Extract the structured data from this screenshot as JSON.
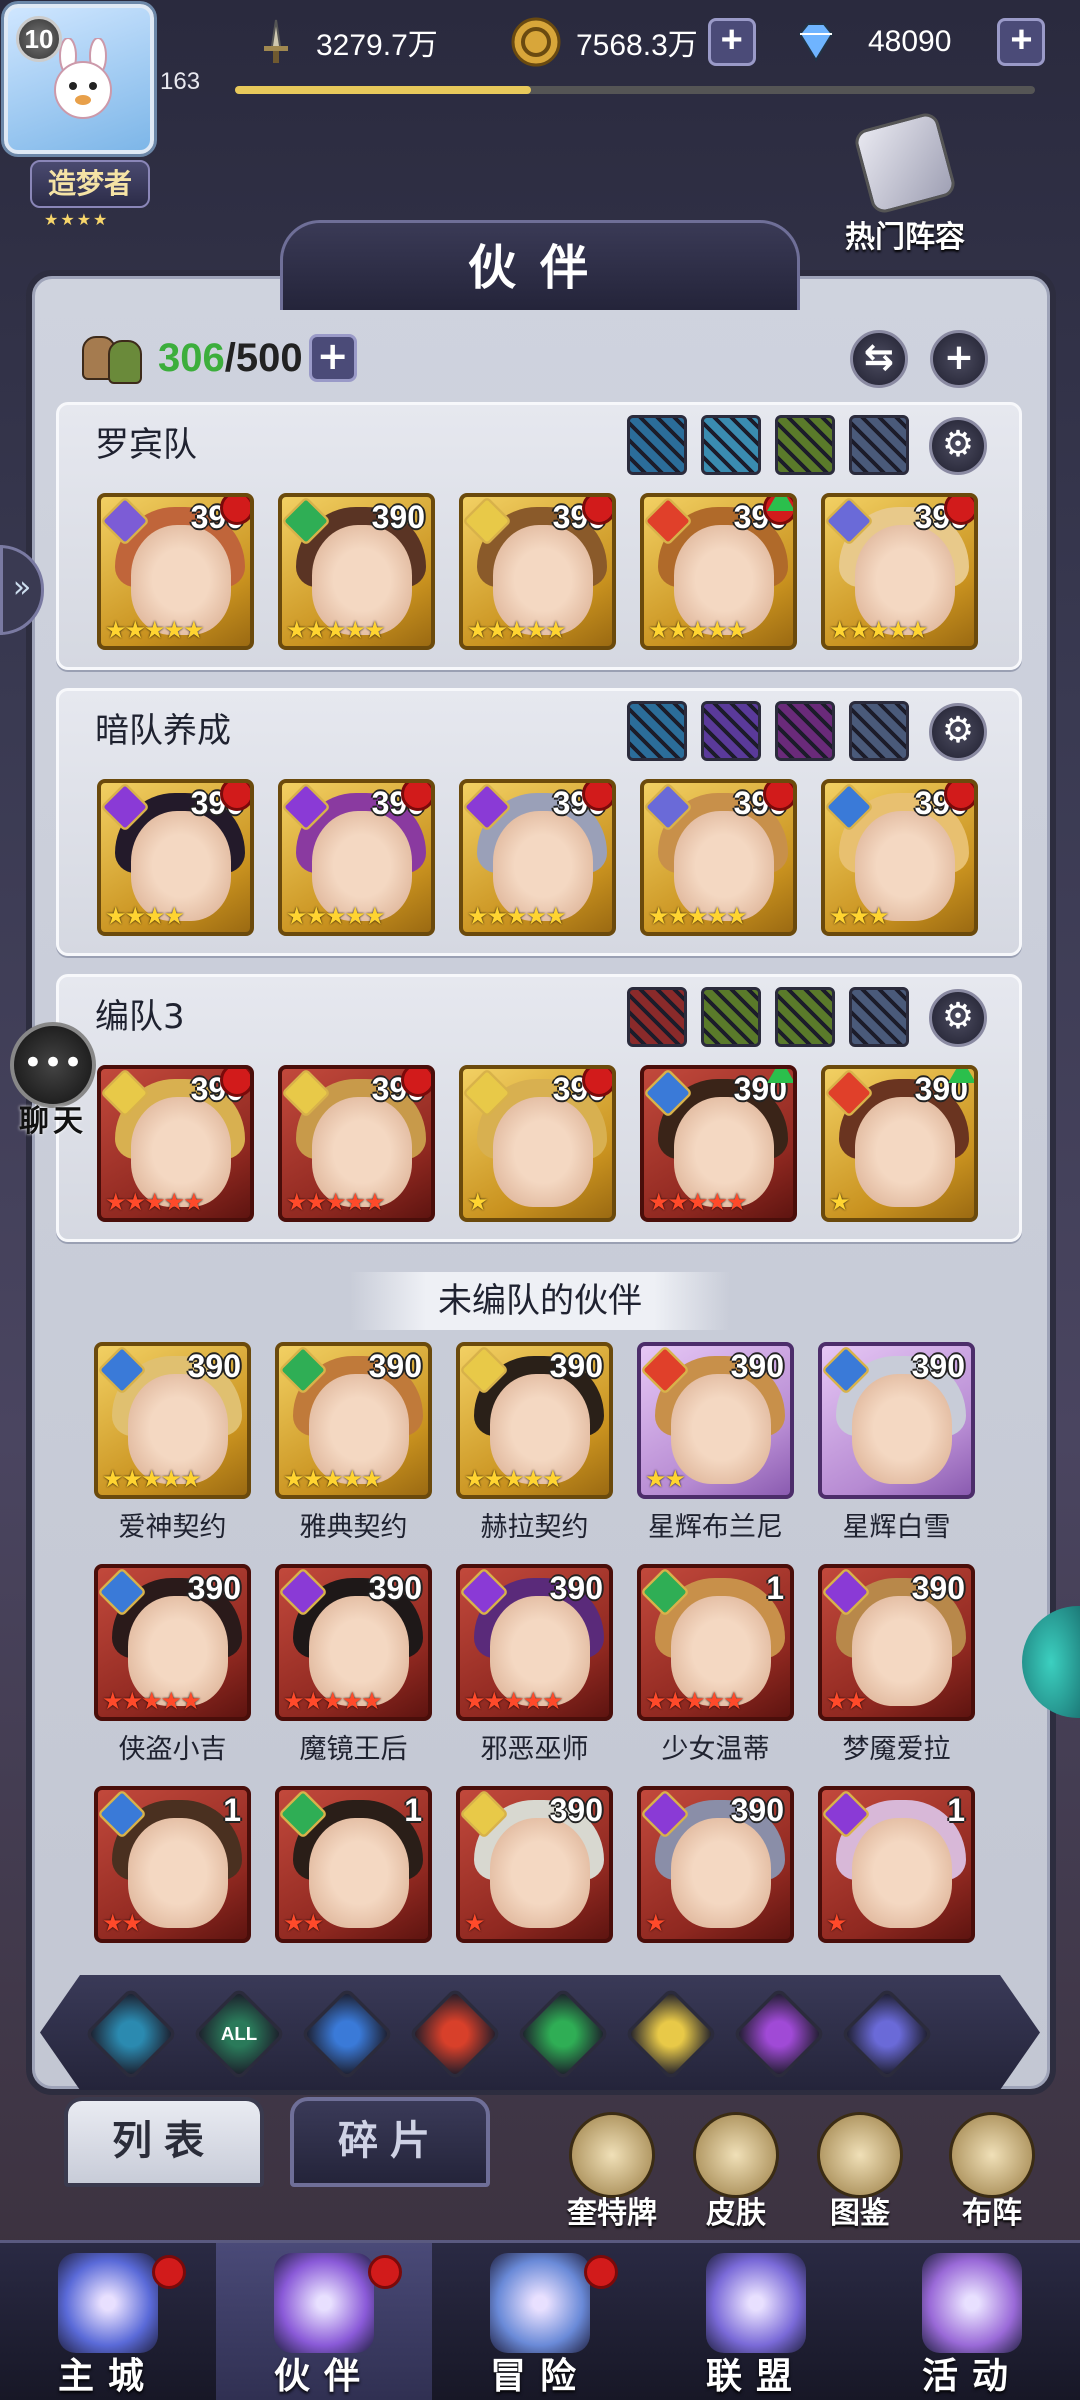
{
  "player": {
    "level": "10",
    "exp_value": "163",
    "exp_fraction": 0.37,
    "title": "造梦者",
    "title_stars": "★★★★"
  },
  "resources": {
    "power": "3279.7万",
    "gold": "7568.3万",
    "diamonds": "48090",
    "plus": "+"
  },
  "hot_lineup_label": "热门阵容",
  "page_title": "伙伴",
  "partner_count": {
    "current": "306",
    "max": "/500"
  },
  "buttons": {
    "swap": "⇆",
    "add": "+",
    "settings": "⚙"
  },
  "teams": [
    {
      "name": "罗宾队",
      "bond_colors": [
        "#2b6d9a",
        "#3a8cb0",
        "#5a7a2a",
        "#4a5a7a"
      ],
      "heroes": [
        {
          "level": "390",
          "frame": "gold",
          "elem": "#7c5cd6",
          "stars": "★★★★★",
          "star_color": "yellow",
          "red_dot": true,
          "up": false,
          "hair": "#c0653a"
        },
        {
          "level": "390",
          "frame": "gold",
          "elem": "#2fae55",
          "stars": "★★★★★",
          "star_color": "yellow",
          "red_dot": false,
          "up": false,
          "hair": "#5a3424"
        },
        {
          "level": "390",
          "frame": "gold",
          "elem": "#e8c948",
          "stars": "★★★★★",
          "star_color": "yellow",
          "red_dot": true,
          "up": false,
          "hair": "#8a5a2a"
        },
        {
          "level": "390",
          "frame": "gold",
          "elem": "#e0402a",
          "stars": "★★★★★",
          "star_color": "yellow",
          "red_dot": true,
          "up": true,
          "hair": "#b06a2a"
        },
        {
          "level": "390",
          "frame": "gold",
          "elem": "#6a6ad8",
          "stars": "★★★★★",
          "star_color": "yellow",
          "red_dot": true,
          "up": false,
          "hair": "#e8c98a"
        }
      ]
    },
    {
      "name": "暗队养成",
      "bond_colors": [
        "#2b6d9a",
        "#5a3a9a",
        "#6a2a7a",
        "#4a5a7a"
      ],
      "heroes": [
        {
          "level": "390",
          "frame": "gold",
          "elem": "#8a3ad6",
          "stars": "★★★★",
          "star_color": "yellow",
          "red_dot": true,
          "up": false,
          "hair": "#231a2a"
        },
        {
          "level": "390",
          "frame": "gold",
          "elem": "#8a3ad6",
          "stars": "★★★★★",
          "star_color": "yellow",
          "red_dot": true,
          "up": false,
          "hair": "#8a3aa0"
        },
        {
          "level": "390",
          "frame": "gold",
          "elem": "#8a3ad6",
          "stars": "★★★★★",
          "star_color": "yellow",
          "red_dot": true,
          "up": false,
          "hair": "#9aa0b8"
        },
        {
          "level": "390",
          "frame": "gold",
          "elem": "#6a6ad8",
          "stars": "★★★★★",
          "star_color": "yellow",
          "red_dot": true,
          "up": false,
          "hair": "#c8904a"
        },
        {
          "level": "390",
          "frame": "gold",
          "elem": "#3a7ad8",
          "stars": "★★★",
          "star_color": "yellow",
          "red_dot": true,
          "up": false,
          "hair": "#e8c070"
        }
      ]
    },
    {
      "name": "编队3",
      "bond_colors": [
        "#8a2a2a",
        "#5a7a2a",
        "#5a7a2a",
        "#4a5a7a"
      ],
      "heroes": [
        {
          "level": "390",
          "frame": "red",
          "elem": "#e8c948",
          "stars": "★★★★★",
          "star_color": "redc",
          "red_dot": true,
          "up": false,
          "hair": "#d8b050"
        },
        {
          "level": "390",
          "frame": "red",
          "elem": "#e8c948",
          "stars": "★★★★★",
          "star_color": "redc",
          "red_dot": true,
          "up": false,
          "hair": "#c89a4a"
        },
        {
          "level": "390",
          "frame": "gold",
          "elem": "#e8c948",
          "stars": "★",
          "star_color": "yellow",
          "red_dot": true,
          "up": false,
          "hair": "#d8b050"
        },
        {
          "level": "390",
          "frame": "red",
          "elem": "#3a7ad8",
          "stars": "★★★★★",
          "star_color": "redc",
          "red_dot": false,
          "up": true,
          "hair": "#3a2418"
        },
        {
          "level": "390",
          "frame": "gold",
          "elem": "#e0402a",
          "stars": "★",
          "star_color": "yellow",
          "red_dot": false,
          "up": true,
          "hair": "#6a3420"
        }
      ]
    }
  ],
  "unassigned_label": "未编队的伙伴",
  "unassigned": [
    [
      {
        "name": "爱神契约",
        "level": "390",
        "frame": "gold",
        "elem": "#3a7ad8",
        "stars": "★★★★★",
        "star_color": "yellow",
        "hair": "#e0c070"
      },
      {
        "name": "雅典契约",
        "level": "390",
        "frame": "gold",
        "elem": "#2fae55",
        "stars": "★★★★★",
        "star_color": "yellow",
        "hair": "#c07a3a"
      },
      {
        "name": "赫拉契约",
        "level": "390",
        "frame": "gold",
        "elem": "#e8c948",
        "stars": "★★★★★",
        "star_color": "yellow",
        "hair": "#2a2018"
      },
      {
        "name": "星辉布兰尼",
        "level": "390",
        "frame": "purple",
        "elem": "#e0402a",
        "stars": "★★",
        "star_color": "yellow",
        "hair": "#c8904a"
      },
      {
        "name": "星辉白雪",
        "level": "390",
        "frame": "purple",
        "elem": "#3a7ad8",
        "stars": "",
        "star_color": "yellow",
        "hair": "#c8ccd8"
      }
    ],
    [
      {
        "name": "侠盗小吉",
        "level": "390",
        "frame": "red",
        "elem": "#3a7ad8",
        "stars": "★★★★★",
        "star_color": "redc",
        "hair": "#2a1a1a"
      },
      {
        "name": "魔镜王后",
        "level": "390",
        "frame": "red",
        "elem": "#8a3ad6",
        "stars": "★★★★★",
        "star_color": "redc",
        "hair": "#1e1818"
      },
      {
        "name": "邪恶巫师",
        "level": "390",
        "frame": "red",
        "elem": "#8a3ad6",
        "stars": "★★★★★",
        "star_color": "redc",
        "hair": "#5a2a7a"
      },
      {
        "name": "少女温蒂",
        "level": "1",
        "frame": "red",
        "elem": "#2fae55",
        "stars": "★★★★★",
        "star_color": "redc",
        "hair": "#c8904a"
      },
      {
        "name": "梦魇爱拉",
        "level": "390",
        "frame": "red",
        "elem": "#8a3ad6",
        "stars": "★★",
        "star_color": "redc",
        "hair": "#b8884a"
      }
    ],
    [
      {
        "name": "",
        "level": "1",
        "frame": "red",
        "elem": "#3a7ad8",
        "stars": "★★",
        "star_color": "redc",
        "hair": "#4a3020"
      },
      {
        "name": "",
        "level": "1",
        "frame": "red",
        "elem": "#2fae55",
        "stars": "★★",
        "star_color": "redc",
        "hair": "#2a1e18"
      },
      {
        "name": "",
        "level": "390",
        "frame": "red",
        "elem": "#e8c948",
        "stars": "★",
        "star_color": "redc",
        "hair": "#d8d8d0"
      },
      {
        "name": "",
        "level": "390",
        "frame": "red",
        "elem": "#8a3ad6",
        "stars": "★",
        "star_color": "redc",
        "hair": "#8a8ea8"
      },
      {
        "name": "",
        "level": "1",
        "frame": "red",
        "elem": "#8a3ad6",
        "stars": "★",
        "star_color": "redc",
        "hair": "#d8b8d8"
      }
    ]
  ],
  "filters": [
    {
      "icon": "water-wave-element-icon",
      "color": "#2b8ab0"
    },
    {
      "icon": "all-elements-icon",
      "label": "ALL",
      "color": "#2a7a5a"
    },
    {
      "icon": "water-drop-element-icon",
      "color": "#3a7ad8"
    },
    {
      "icon": "fire-element-icon",
      "color": "#d8402a"
    },
    {
      "icon": "wind-element-icon",
      "color": "#2fae55"
    },
    {
      "icon": "light-element-icon",
      "color": "#e8c948"
    },
    {
      "icon": "dark-moon-element-icon",
      "color": "#a04ad6"
    },
    {
      "icon": "planet-element-icon",
      "color": "#6a6ad8"
    }
  ],
  "tabs": {
    "list": "列表",
    "fragments": "碎片"
  },
  "tools": [
    "奎特牌",
    "皮肤",
    "图鉴",
    "布阵"
  ],
  "chat_label": "聊天",
  "nav": [
    {
      "label": "主城",
      "icon": "castle-icon",
      "dot": true,
      "active": false,
      "color": "#5a6ad8"
    },
    {
      "label": "伙伴",
      "icon": "partner-hat-icon",
      "dot": true,
      "active": true,
      "color": "#8a5ad8"
    },
    {
      "label": "冒险",
      "icon": "adventure-compass-icon",
      "dot": true,
      "active": false,
      "color": "#6a8ad8"
    },
    {
      "label": "联盟",
      "icon": "alliance-shield-icon",
      "dot": false,
      "active": false,
      "color": "#7a6ad8"
    },
    {
      "label": "活动",
      "icon": "event-cards-icon",
      "dot": false,
      "active": false,
      "color": "#9a6ad8"
    }
  ]
}
